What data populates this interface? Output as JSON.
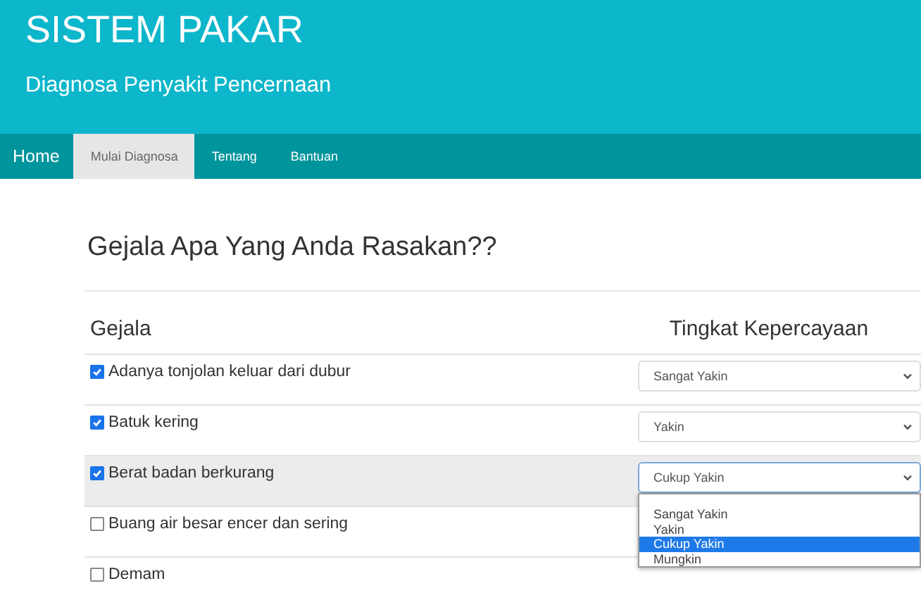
{
  "header": {
    "title": "SISTEM PAKAR",
    "subtitle": "Diagnosa Penyakit Pencernaan"
  },
  "nav": {
    "brand": "Home",
    "tabs": [
      {
        "label": "Mulai Diagnosa",
        "selected": true
      },
      {
        "label": "Tentang",
        "selected": false
      },
      {
        "label": "Bantuan",
        "selected": false
      }
    ]
  },
  "heading": "Gejala Apa Yang Anda Rasakan??",
  "table": {
    "columns": [
      "Gejala",
      "Tingkat Kepercayaan"
    ],
    "rows": [
      {
        "symptom": "Adanya tonjolan keluar dari dubur",
        "checked": true,
        "highlighted": false,
        "confidence": "Sangat Yakin",
        "expanded": false
      },
      {
        "symptom": "Batuk kering",
        "checked": true,
        "highlighted": false,
        "confidence": "Yakin",
        "expanded": false
      },
      {
        "symptom": "Berat badan berkurang",
        "checked": true,
        "highlighted": true,
        "confidence": "Cukup Yakin",
        "expanded": true,
        "options": [
          {
            "label": "Sangat Yakin",
            "selected": false
          },
          {
            "label": "Yakin",
            "selected": false
          },
          {
            "label": "Cukup Yakin",
            "selected": true
          },
          {
            "label": "Mungkin",
            "selected": false
          }
        ]
      },
      {
        "symptom": "Buang air besar encer dan sering",
        "checked": false,
        "highlighted": false
      },
      {
        "symptom": "Demam",
        "checked": false,
        "highlighted": false
      }
    ]
  }
}
